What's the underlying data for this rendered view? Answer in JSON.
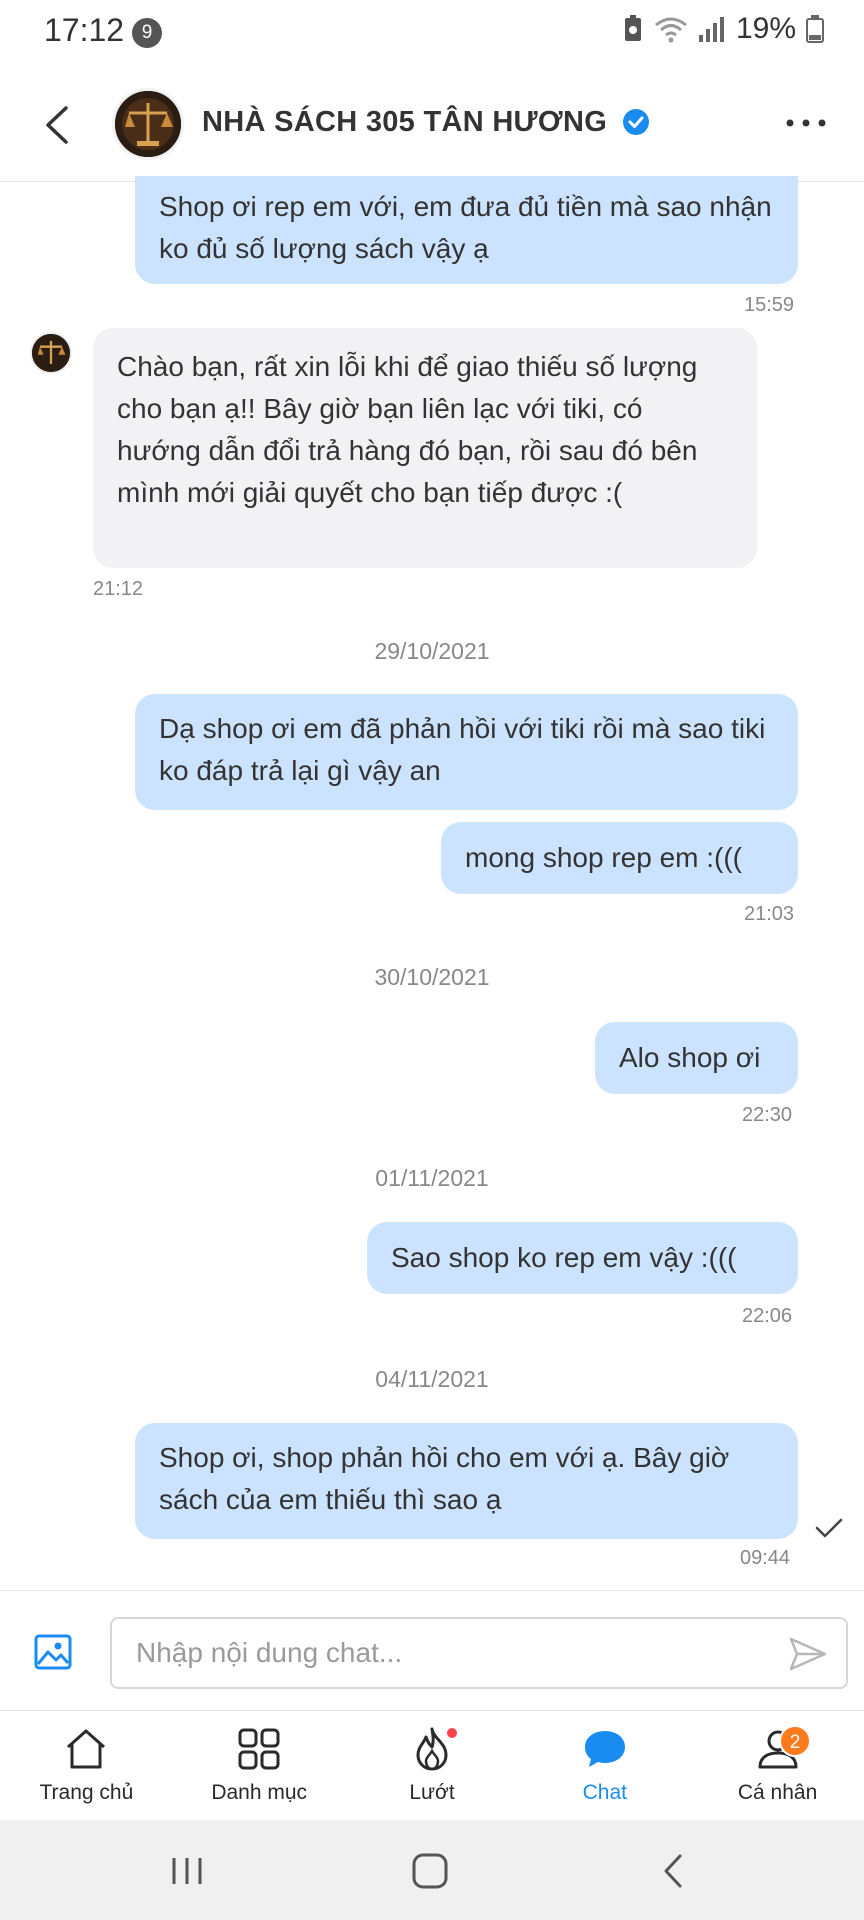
{
  "status_bar": {
    "time": "17:12",
    "notification_count": "9",
    "battery": "19%"
  },
  "header": {
    "shop_name": "NHÀ SÁCH 305 TÂN HƯƠNG"
  },
  "messages": [
    {
      "text": "Shop ơi rep em với, em đưa đủ tiền mà sao nhận ko đủ số lượng sách vậy ạ",
      "time": "15:59"
    },
    {
      "text": "Chào bạn, rất xin lỗi khi để giao thiếu số lượng cho bạn ạ!! Bây giờ bạn liên lạc với tiki, có hướng dẫn đổi trả hàng đó bạn, rồi sau đó bên mình mới giải quyết cho bạn tiếp được :(",
      "time": "21:12"
    },
    {
      "date": "29/10/2021"
    },
    {
      "text": "Dạ shop ơi em đã phản hồi với tiki rồi mà sao tiki ko đáp trả lại gì vậy an"
    },
    {
      "text": "mong shop rep em :(((",
      "time": "21:03"
    },
    {
      "date": "30/10/2021"
    },
    {
      "text": "Alo shop ơi",
      "time": "22:30"
    },
    {
      "date": "01/11/2021"
    },
    {
      "text": "Sao shop ko rep em vậy :(((",
      "time": "22:06"
    },
    {
      "date": "04/11/2021"
    },
    {
      "text": "Shop ơi, shop phản hồi cho em với ạ. Bây giờ sách của em thiếu thì sao ạ",
      "time": "09:44"
    }
  ],
  "input": {
    "placeholder": "Nhập nội dung chat..."
  },
  "bottom_nav": {
    "items": [
      {
        "label": "Trang chủ"
      },
      {
        "label": "Danh mục"
      },
      {
        "label": "Lướt"
      },
      {
        "label": "Chat"
      },
      {
        "label": "Cá nhân",
        "badge": "2"
      }
    ],
    "active": "Chat"
  },
  "colors": {
    "accent": "#1a8cf0",
    "outgoing_bubble": "#cce3ff",
    "incoming_bubble": "#f2f2f4",
    "badge": "#ff7a1a",
    "dot": "#ff424e"
  },
  "icons": [
    "back-icon",
    "verified-icon",
    "more-icon",
    "image-icon",
    "send-icon",
    "home-icon",
    "grid-icon",
    "flame-icon",
    "chat-bubble-icon",
    "user-icon"
  ]
}
